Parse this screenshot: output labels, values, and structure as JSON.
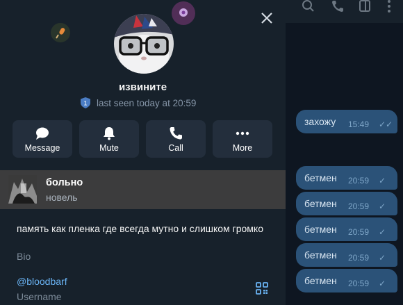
{
  "profile": {
    "name": "извините",
    "status": "last seen today at 20:59",
    "shield_number": "1"
  },
  "actions": [
    {
      "label": "Message",
      "icon": "message-icon"
    },
    {
      "label": "Mute",
      "icon": "bell-icon"
    },
    {
      "label": "Call",
      "icon": "phone-icon"
    },
    {
      "label": "More",
      "icon": "more-dots-icon"
    }
  ],
  "channel": {
    "title": "больно",
    "subtitle": "новель"
  },
  "bio": {
    "text": "память как пленка где всегда мутно и слишком громко",
    "label": "Bio"
  },
  "username": {
    "value": "@bloodbarf",
    "label": "Username"
  },
  "chat": {
    "messages": [
      {
        "text": "захожу",
        "time": "15:49",
        "status": "read"
      },
      {
        "text": "бетмен",
        "time": "20:59",
        "status": "sent"
      },
      {
        "text": "бетмен",
        "time": "20:59",
        "status": "sent"
      },
      {
        "text": "бетмен",
        "time": "20:59",
        "status": "sent"
      },
      {
        "text": "бетмен",
        "time": "20:59",
        "status": "sent"
      },
      {
        "text": "бетмен",
        "time": "20:59",
        "status": "sent"
      }
    ]
  },
  "colors": {
    "panel_bg": "#17212b",
    "button_bg": "#232e3c",
    "link": "#6ab3f3",
    "bubble": "#2b5278",
    "channel_row": "#3c3c3d"
  }
}
